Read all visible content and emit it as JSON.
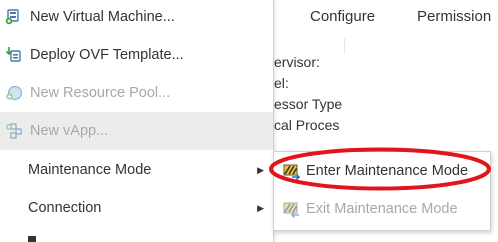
{
  "background": {
    "tabs": [
      "Configure",
      "Permission"
    ],
    "properties": [
      "ervisor:",
      "el:",
      "essor Type",
      "cal Proces"
    ]
  },
  "menu": {
    "items": [
      {
        "label": "New Virtual Machine...",
        "icon": "new-vm-icon",
        "disabled": false
      },
      {
        "label": "Deploy OVF Template...",
        "icon": "deploy-ovf-icon",
        "disabled": false
      },
      {
        "label": "New Resource Pool...",
        "icon": "resource-pool-icon",
        "disabled": true
      },
      {
        "label": "New vApp...",
        "icon": "vapp-icon",
        "disabled": true
      },
      {
        "label": "Maintenance Mode",
        "icon": null,
        "disabled": false,
        "has_submenu": true
      },
      {
        "label": "Connection",
        "icon": null,
        "disabled": false,
        "has_submenu": true
      }
    ],
    "submenu_arrow": "▶"
  },
  "submenu": {
    "items": [
      {
        "label": "Enter Maintenance Mode",
        "icon": "enter-maintenance-icon",
        "disabled": false
      },
      {
        "label": "Exit Maintenance Mode",
        "icon": "exit-maintenance-icon",
        "disabled": true
      }
    ]
  },
  "colors": {
    "highlight_ellipse": "#e0161b",
    "disabled_text": "#a8a8a8",
    "hover_bg": "#ececec"
  }
}
